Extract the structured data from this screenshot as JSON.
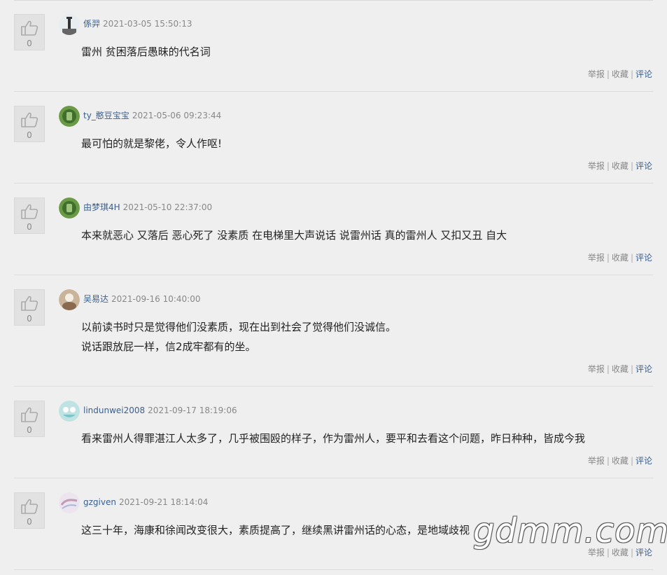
{
  "comments": [
    {
      "likes": "0",
      "user": "係羿",
      "time": "2021-03-05 15:50:13",
      "lines": [
        "雷州 贫困落后愚昧的代名词"
      ],
      "avatar_color": "#cfd8dc",
      "actions": {
        "report": "举报",
        "collect": "收藏",
        "reply": "评论"
      }
    },
    {
      "likes": "0",
      "user": "ty_憨豆宝宝",
      "time": "2021-05-06 09:23:44",
      "lines": [
        "最可怕的就是黎佬，令人作呕!"
      ],
      "avatar_color": "#5f8f3f",
      "actions": {
        "report": "举报",
        "collect": "收藏",
        "reply": "评论"
      }
    },
    {
      "likes": "0",
      "user": "由梦琪4H",
      "time": "2021-05-10 22:37:00",
      "lines": [
        "本来就恶心 又落后 恶心死了 没素质 在电梯里大声说话 说雷州话 真的雷州人 又扣又丑 自大"
      ],
      "avatar_color": "#5f8f3f",
      "actions": {
        "report": "举报",
        "collect": "收藏",
        "reply": "评论"
      }
    },
    {
      "likes": "0",
      "user": "吴易达",
      "time": "2021-09-16 10:40:00",
      "lines": [
        "以前读书时只是觉得他们没素质，现在出到社会了觉得他们没诚信。",
        "说话跟放屁一样，信2成牢都有的坐。"
      ],
      "avatar_color": "#b89a7a",
      "actions": {
        "report": "举报",
        "collect": "收藏",
        "reply": "评论"
      }
    },
    {
      "likes": "0",
      "user": "lindunwei2008",
      "time": "2021-09-17 18:19:06",
      "lines": [
        "看来雷州人得罪湛江人太多了，几乎被围殴的样子，作为雷州人，要平和去看这个问题，昨日种种，皆成今我"
      ],
      "avatar_color": "#9fd3d6",
      "actions": {
        "report": "举报",
        "collect": "收藏",
        "reply": "评论"
      }
    },
    {
      "likes": "0",
      "user": "gzgiven",
      "time": "2021-09-21 18:14:04",
      "lines": [
        "这三十年，海康和徐闻改变很大，素质提高了，继续黑讲雷州话的心态，是地域歧视"
      ],
      "avatar_color": "#d8c8d8",
      "actions": {
        "report": "举报",
        "collect": "收藏",
        "reply": "评论"
      }
    }
  ],
  "watermark": "gdmm.com"
}
